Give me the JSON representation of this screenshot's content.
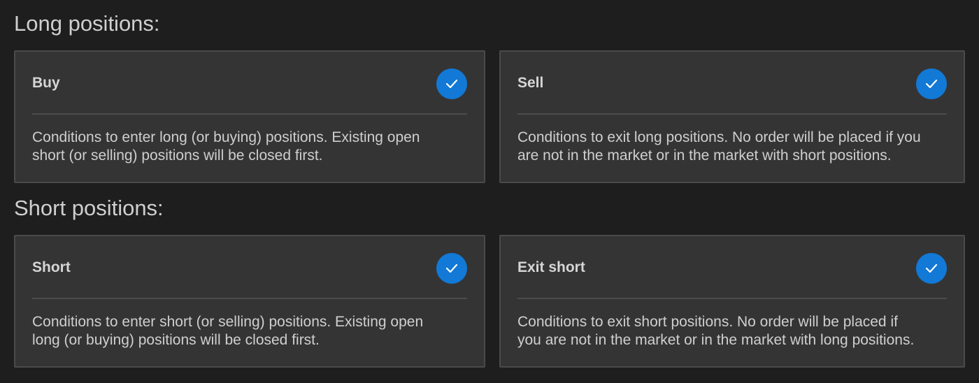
{
  "sections": [
    {
      "title": "Long positions:",
      "cards": [
        {
          "title": "Buy",
          "checked": true,
          "description": "Conditions to enter long (or buying) positions. Existing open\nshort (or selling) positions will be closed first."
        },
        {
          "title": "Sell",
          "checked": true,
          "description": "Conditions to exit long positions.  No order will be placed if you\nare not in the market or in the market with short positions."
        }
      ]
    },
    {
      "title": "Short positions:",
      "cards": [
        {
          "title": "Short",
          "checked": true,
          "description": "Conditions to enter short (or selling) positions. Existing open\nlong (or buying) positions will be closed first."
        },
        {
          "title": "Exit short",
          "checked": true,
          "description": "Conditions to exit short positions.  No order will be placed if\nyou are not in the market or in the market with long positions."
        }
      ]
    }
  ],
  "colors": {
    "background": "#1e1e1e",
    "card": "#343434",
    "accent": "#1279d6",
    "text": "#cfcfcf"
  },
  "icons": {
    "check": "checkmark-icon"
  }
}
